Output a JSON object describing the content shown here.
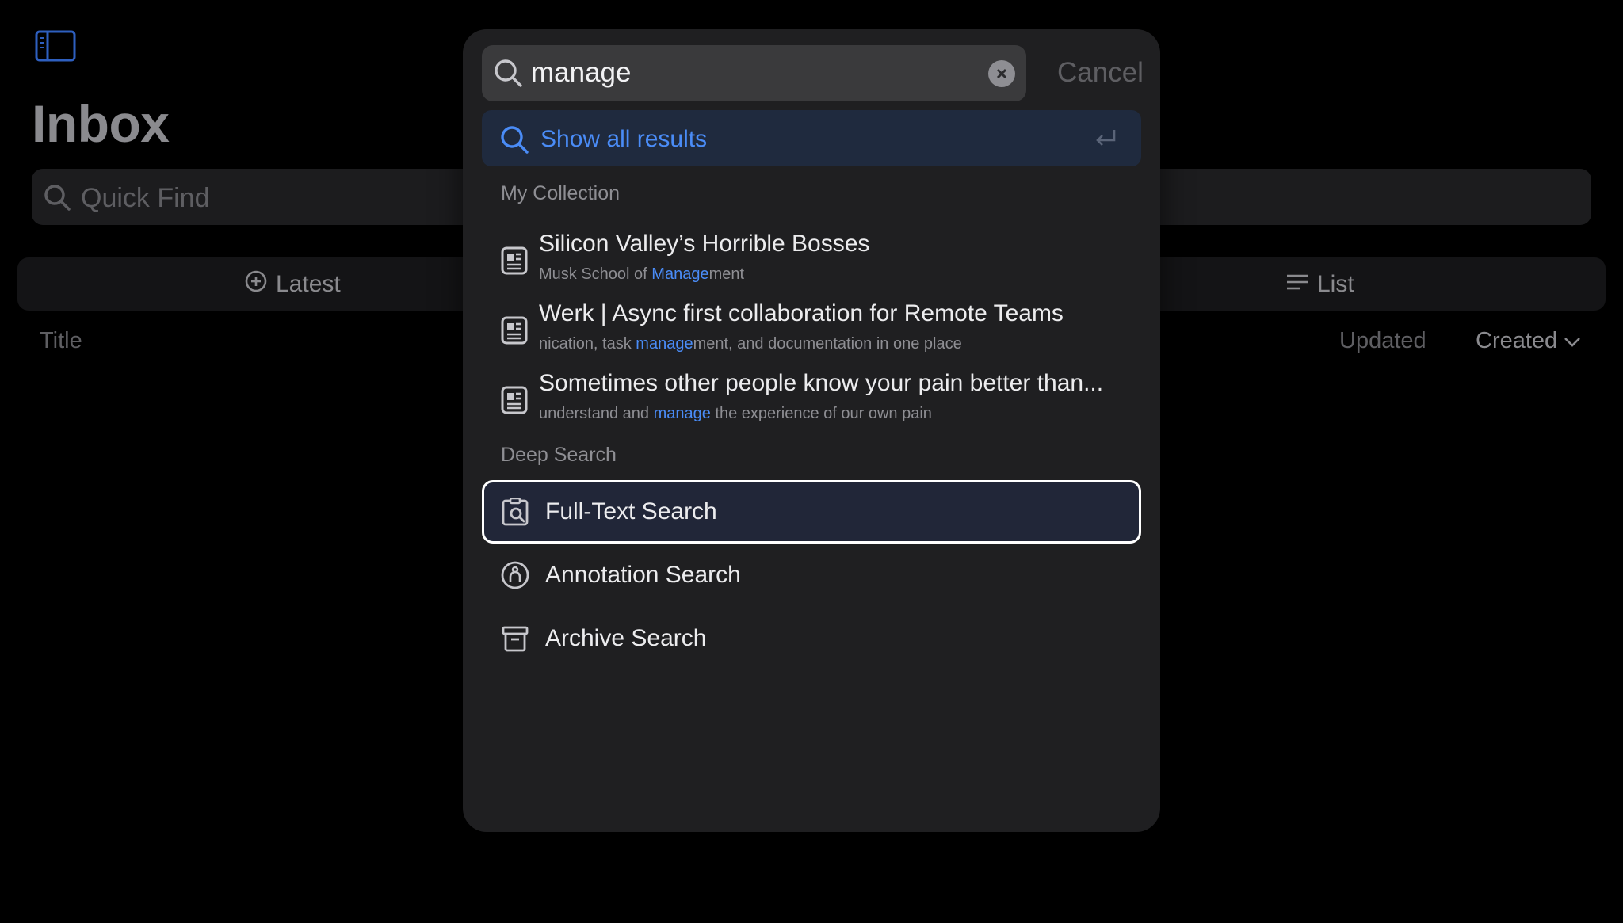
{
  "background": {
    "page_title": "Inbox",
    "quick_find_placeholder": "Quick Find",
    "view_tabs": [
      {
        "label": "Latest",
        "icon": "plus-clock-icon"
      },
      {
        "label": "List",
        "icon": "list-lines-icon"
      }
    ],
    "columns": {
      "title": "Title",
      "updated": "Updated",
      "created": "Created"
    }
  },
  "search": {
    "query": "manage",
    "cancel_label": "Cancel",
    "show_all_label": "Show all results",
    "sections": {
      "collection": "My Collection",
      "deep": "Deep Search"
    },
    "results": [
      {
        "title": "Silicon Valley’s Horrible Bosses",
        "snippet_before": "Musk School of ",
        "snippet_match": "Manage",
        "snippet_after": "ment"
      },
      {
        "title": "Werk | Async first collaboration for Remote Teams",
        "snippet_before": "nication, task ",
        "snippet_match": "manage",
        "snippet_after": "ment, and documentation in one place"
      },
      {
        "title": "Sometimes other people know your pain better than...",
        "snippet_before": "understand and ",
        "snippet_match": "manage",
        "snippet_after": " the experience of our own pain"
      }
    ],
    "deep_search": [
      {
        "label": "Full-Text Search",
        "icon": "doc-search-icon",
        "selected": true
      },
      {
        "label": "Annotation Search",
        "icon": "annotation-icon",
        "selected": false
      },
      {
        "label": "Archive Search",
        "icon": "archive-box-icon",
        "selected": false
      }
    ]
  },
  "colors": {
    "accent": "#4a8cf7",
    "panel_bg": "#1f1f21",
    "page_bg": "#000000",
    "selected_bg": "#212638"
  }
}
